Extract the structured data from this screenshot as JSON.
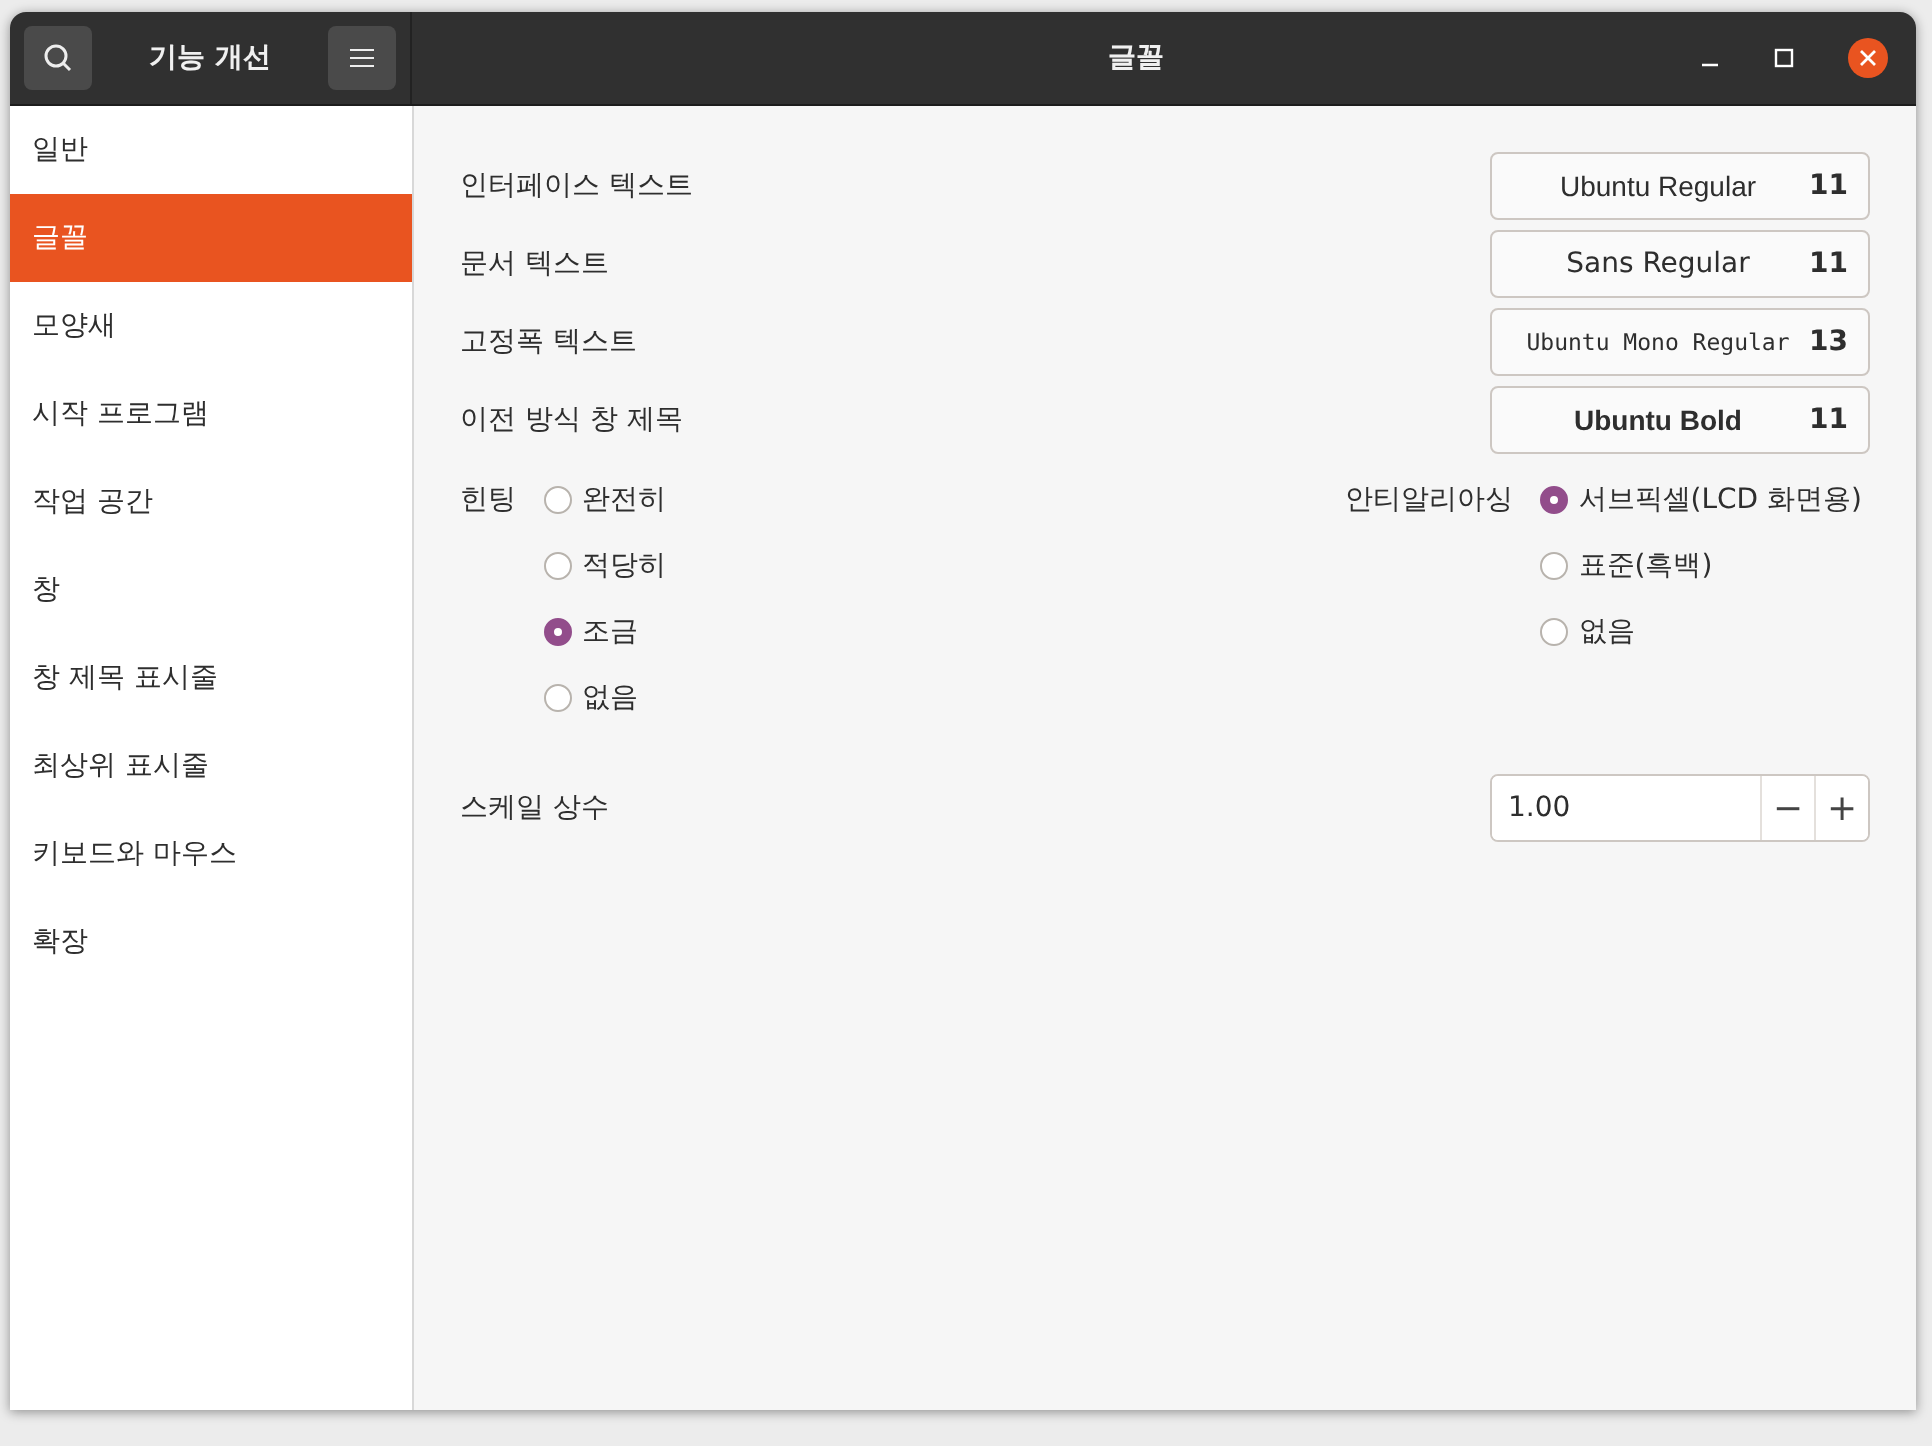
{
  "header": {
    "sidebar_title": "기능 개선",
    "window_title": "글꼴"
  },
  "sidebar": {
    "items": [
      {
        "label": "일반",
        "selected": false
      },
      {
        "label": "글꼴",
        "selected": true
      },
      {
        "label": "모양새",
        "selected": false
      },
      {
        "label": "시작 프로그램",
        "selected": false
      },
      {
        "label": "작업 공간",
        "selected": false
      },
      {
        "label": "창",
        "selected": false
      },
      {
        "label": "창 제목 표시줄",
        "selected": false
      },
      {
        "label": "최상위 표시줄",
        "selected": false
      },
      {
        "label": "키보드와 마우스",
        "selected": false
      },
      {
        "label": "확장",
        "selected": false
      }
    ]
  },
  "fonts": [
    {
      "label": "인터페이스 텍스트",
      "font": "Ubuntu Regular",
      "size": "11",
      "kind": "regular"
    },
    {
      "label": "문서 텍스트",
      "font": "Sans Regular",
      "size": "11",
      "kind": "sans"
    },
    {
      "label": "고정폭 텍스트",
      "font": "Ubuntu Mono Regular",
      "size": "13",
      "kind": "mono"
    },
    {
      "label": "이전 방식 창 제목",
      "font": "Ubuntu Bold",
      "size": "11",
      "kind": "bold"
    }
  ],
  "hinting": {
    "label": "힌팅",
    "options": [
      {
        "label": "완전히",
        "selected": false
      },
      {
        "label": "적당히",
        "selected": false
      },
      {
        "label": "조금",
        "selected": true
      },
      {
        "label": "없음",
        "selected": false
      }
    ]
  },
  "antialiasing": {
    "label": "안티알리아싱",
    "options": [
      {
        "label": "서브픽셀(LCD 화면용)",
        "selected": true
      },
      {
        "label": "표준(흑백)",
        "selected": false
      },
      {
        "label": "없음",
        "selected": false
      }
    ]
  },
  "scale": {
    "label": "스케일 상수",
    "value": "1.00",
    "decrement": "−",
    "increment": "+"
  }
}
